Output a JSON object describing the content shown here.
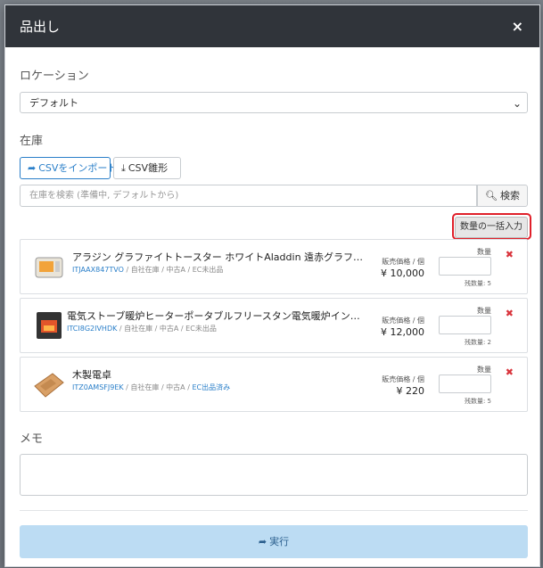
{
  "modal": {
    "title": "品出し",
    "close": "×"
  },
  "location": {
    "label": "ロケーション",
    "selected": "デフォルト"
  },
  "stock": {
    "label": "在庫",
    "import_btn": "CSVをインポート",
    "template_btn": "CSV雛形",
    "search_placeholder": "在庫を検索 (準備中, デフォルトから)",
    "search_btn": "検索",
    "bulk_btn": "数量の一括入力"
  },
  "items": [
    {
      "name": "アラジン グラファイトトースター ホワイトAladdin 遠赤グラファイトトースター AET-...",
      "code": "ITJAAX847TVO",
      "meta": " / 自社在庫 / 中古A / EC未出品",
      "ec": "",
      "price_label": "販売価格 / 個",
      "price": "¥ 10,000",
      "qty_label": "数量",
      "remain": "残数量: 5",
      "delete": "✖"
    },
    {
      "name": "電気ストーブ暖炉ヒーターポータブルフリースタン電気暖炉インサートストーブヒーター...",
      "code": "ITCI8G2IVHDK",
      "meta": " / 自社在庫 / 中古A / EC未出品",
      "ec": "",
      "price_label": "販売価格 / 個",
      "price": "¥ 12,000",
      "qty_label": "数量",
      "remain": "残数量: 2",
      "delete": "✖"
    },
    {
      "name": "木製電卓",
      "code": "ITZ0AMSFJ9EK",
      "meta": " / 自社在庫 / 中古A / ",
      "ec": "EC出品済み",
      "price_label": "販売価格 / 個",
      "price": "¥ 220",
      "qty_label": "数量",
      "remain": "残数量: 5",
      "delete": "✖"
    }
  ],
  "memo": {
    "label": "メモ"
  },
  "exec": {
    "label": "実行"
  }
}
